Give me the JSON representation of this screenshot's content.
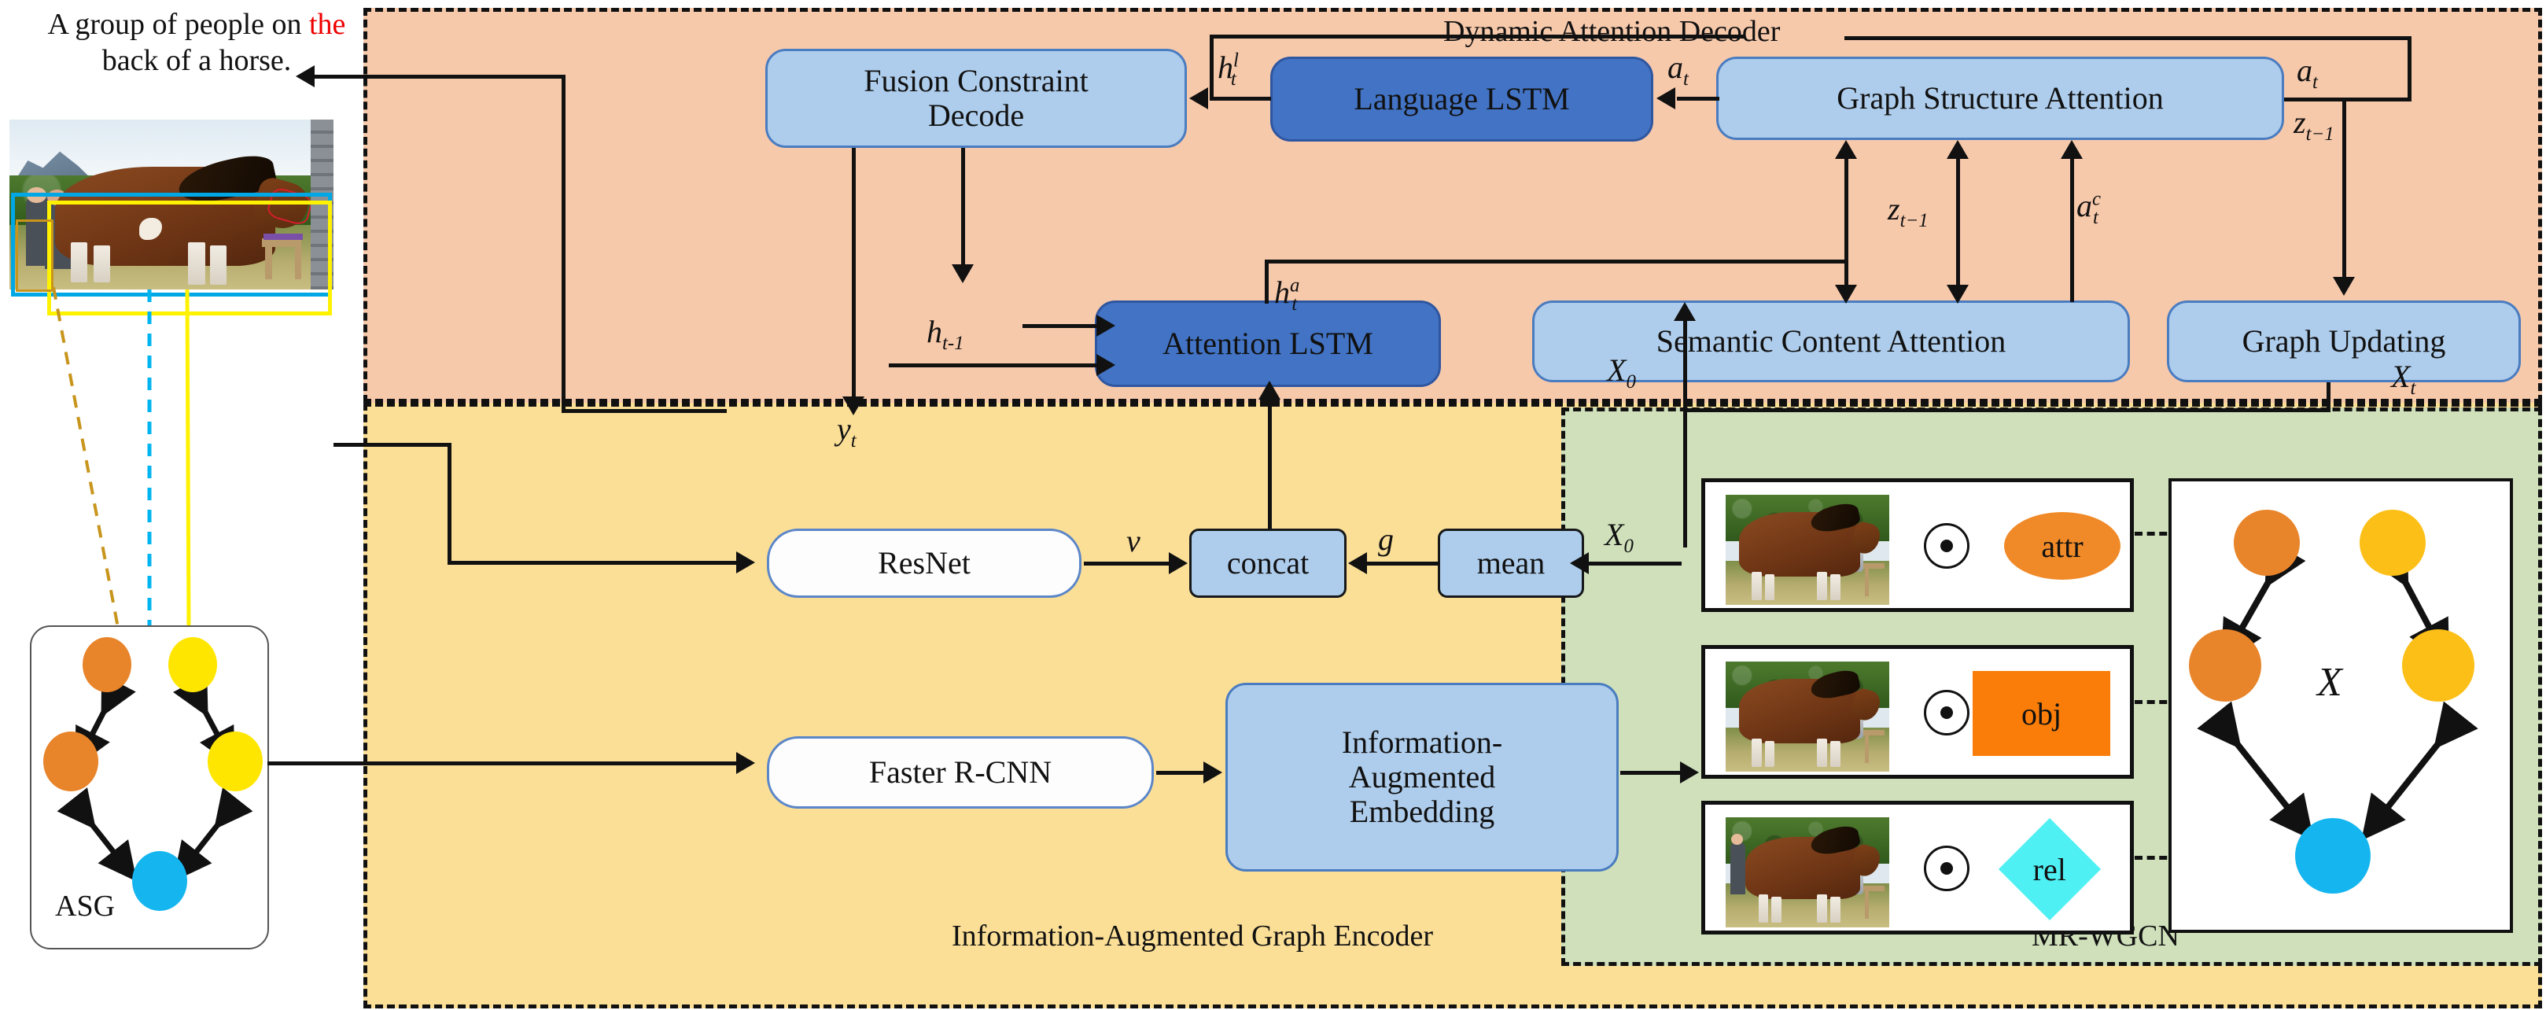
{
  "caption": {
    "line1_pre": "A group of people on ",
    "line1_hl": "the",
    "line2": "back of a horse."
  },
  "asg": {
    "label": "ASG"
  },
  "frames": {
    "decoder_label": "Dynamic Attention Decoder",
    "encoder_label": "Information-Augmented Graph Encoder",
    "mrwgcn_label": "MR-WGCN"
  },
  "decoder": {
    "fusion_constraint_decode": "Fusion Constraint\nDecode",
    "language_lstm": "Language LSTM",
    "graph_structure_attention": "Graph Structure Attention",
    "attention_lstm": "Attention LSTM",
    "semantic_content_attention": "Semantic Content Attention",
    "graph_updating": "Graph Updating"
  },
  "encoder": {
    "resnet": "ResNet",
    "concat": "concat",
    "mean": "mean",
    "faster_rcnn": "Faster R-CNN",
    "info_aug_embedding": "Information-\nAugmented\nEmbedding"
  },
  "math_labels": {
    "h_t_l": "h",
    "h_t_l_sup": "l",
    "h_t_l_sub": "t",
    "a_t": "a",
    "a_t_sub": "t",
    "a_t_right": "a",
    "a_t_right_sub": "t",
    "z_t_minus_1_right": "z",
    "z_t_minus_1_right_sub": "t−1",
    "z_t_minus_1_mid": "z",
    "z_t_minus_1_mid_sub": "t−1",
    "a_t_c": "a",
    "a_t_c_sup": "c",
    "a_t_c_sub": "t",
    "h_t_a": "h",
    "h_t_a_sup": "a",
    "h_t_a_sub": "t",
    "h_t_minus_1": "h",
    "h_t_minus_1_sub": "t-1",
    "y_t": "y",
    "y_t_sub": "t",
    "v": "v",
    "g": "g",
    "X_0": "X",
    "X_0_sub": "0",
    "X_t": "X",
    "X_t_sub": "t",
    "X_0_enc": "X",
    "X_0_enc_sub": "0",
    "X_graph": "X"
  },
  "mrwgcn": {
    "rows": [
      {
        "tag": "attr",
        "shape": "ellipse",
        "color": "#f08a28"
      },
      {
        "tag": "obj",
        "shape": "rect",
        "color": "#fa7d09"
      },
      {
        "tag": "rel",
        "shape": "diamond",
        "color": "#4ef0f4"
      }
    ],
    "operator_icon": "dot-product-icon",
    "graph_label": "X",
    "graph_nodes": [
      {
        "name": "attr-node-top",
        "color": "#e8842a"
      },
      {
        "name": "object-node-top",
        "color": "#fcbf17"
      },
      {
        "name": "attr-node-left",
        "color": "#e8842a"
      },
      {
        "name": "object-node-right",
        "color": "#fcbf17"
      },
      {
        "name": "relation-node",
        "color": "#15b6ef"
      }
    ]
  },
  "asg_graph": {
    "nodes": [
      {
        "name": "attr-node-top",
        "color": "#e8842a"
      },
      {
        "name": "object-node-top",
        "color": "#ffe600"
      },
      {
        "name": "attr-node-left",
        "color": "#e8842a"
      },
      {
        "name": "object-node-right",
        "color": "#ffe600"
      },
      {
        "name": "relation-node",
        "color": "#15b6ef"
      }
    ]
  },
  "colors": {
    "decoder_bg": "#f7c9ab",
    "encoder_bg": "#fbdf97",
    "mrwgcn_bg": "#cfe0bb",
    "module_light": "#aecdec",
    "module_dark": "#4273c4",
    "accent_red": "#ee0000",
    "bbox_cyan": "#00a7e5",
    "bbox_yellow": "#fff200",
    "bbox_gold": "#c8951c"
  }
}
